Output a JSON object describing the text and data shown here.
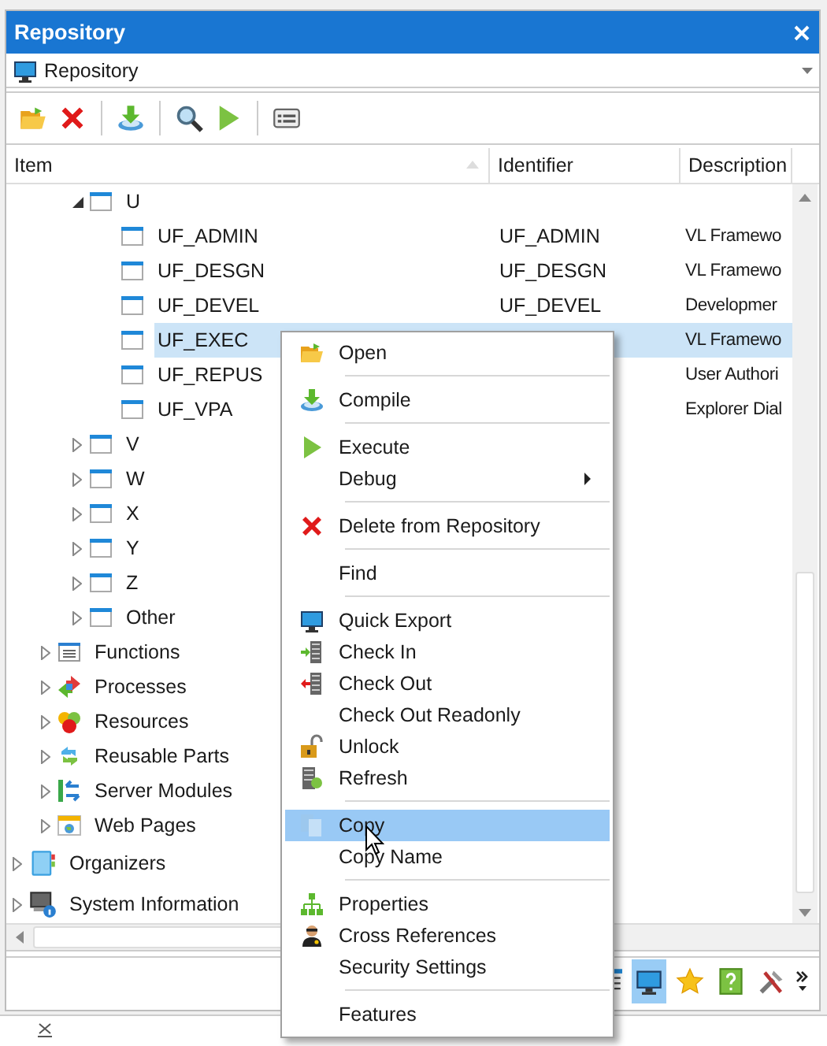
{
  "window": {
    "title": "Repository"
  },
  "selector": {
    "value": "Repository"
  },
  "table": {
    "columns": [
      "Item",
      "Identifier",
      "Description"
    ]
  },
  "tree": {
    "items": [
      {
        "children": [
          {
            "children": [
              {
                "label": "U",
                "kind": "table",
                "expanded": true,
                "selected": false,
                "children": [
                  {
                    "label": "UF_ADMIN",
                    "kind": "table",
                    "identifier": "UF_ADMIN",
                    "description": "VL Framewo",
                    "selected": false
                  },
                  {
                    "label": "UF_DESGN",
                    "kind": "table",
                    "identifier": "UF_DESGN",
                    "description": "VL Framewo",
                    "selected": false
                  },
                  {
                    "label": "UF_DEVEL",
                    "kind": "table",
                    "identifier": "UF_DEVEL",
                    "description": "Developmer",
                    "selected": false
                  },
                  {
                    "label": "UF_EXEC",
                    "kind": "table",
                    "description": "VL Framewo",
                    "selected": true
                  },
                  {
                    "label": "UF_REPUS",
                    "kind": "table",
                    "description": "User Authori",
                    "selected": false
                  },
                  {
                    "label": "UF_VPA",
                    "kind": "table",
                    "description": "Explorer Dial",
                    "selected": false
                  }
                ]
              },
              {
                "label": "V",
                "kind": "table",
                "expanded": false,
                "selected": false
              },
              {
                "label": "W",
                "kind": "table",
                "expanded": false,
                "selected": false
              },
              {
                "label": "X",
                "kind": "table",
                "expanded": false,
                "selected": false
              },
              {
                "label": "Y",
                "kind": "table",
                "expanded": false,
                "selected": false
              },
              {
                "label": "Z",
                "kind": "table",
                "expanded": false,
                "selected": false
              },
              {
                "label": "Other",
                "kind": "table",
                "expanded": false,
                "selected": false
              }
            ]
          },
          {
            "label": "Functions",
            "kind": "functions",
            "expanded": false,
            "selected": false
          },
          {
            "label": "Processes",
            "kind": "processes",
            "expanded": false,
            "selected": false
          },
          {
            "label": "Resources",
            "kind": "resources",
            "expanded": false,
            "selected": false
          },
          {
            "label": "Reusable Parts",
            "kind": "reusable",
            "expanded": false,
            "selected": false
          },
          {
            "label": "Server Modules",
            "kind": "server",
            "expanded": false,
            "selected": false
          },
          {
            "label": "Web Pages",
            "kind": "web",
            "expanded": false,
            "selected": false
          }
        ]
      },
      {
        "label": "Organizers",
        "kind": "organizers",
        "expanded": false,
        "selected": false
      },
      {
        "label": "System Information",
        "kind": "system",
        "expanded": false,
        "selected": false
      }
    ]
  },
  "context_menu": {
    "items": [
      {
        "kind": "item",
        "label": "Open",
        "selected": false
      },
      {
        "kind": "separator"
      },
      {
        "kind": "item",
        "label": "Compile",
        "selected": false
      },
      {
        "kind": "separator"
      },
      {
        "kind": "item",
        "label": "Execute",
        "selected": false
      },
      {
        "kind": "submenu",
        "label": "Debug",
        "selected": false
      },
      {
        "kind": "separator"
      },
      {
        "kind": "item",
        "label": "Delete from Repository",
        "selected": false
      },
      {
        "kind": "separator"
      },
      {
        "kind": "item",
        "label": "Find",
        "selected": false
      },
      {
        "kind": "separator"
      },
      {
        "kind": "item",
        "label": "Quick Export",
        "selected": false
      },
      {
        "kind": "item",
        "label": "Check In",
        "selected": false
      },
      {
        "kind": "item",
        "label": "Check Out",
        "selected": false
      },
      {
        "kind": "item",
        "label": "Check Out Readonly",
        "selected": false
      },
      {
        "kind": "item",
        "label": "Unlock",
        "selected": false
      },
      {
        "kind": "item",
        "label": "Refresh",
        "selected": false
      },
      {
        "kind": "separator"
      },
      {
        "kind": "item",
        "label": "Copy",
        "selected": true
      },
      {
        "kind": "item",
        "label": "Copy Name",
        "selected": false
      },
      {
        "kind": "separator"
      },
      {
        "kind": "item",
        "label": "Properties",
        "selected": false
      },
      {
        "kind": "item",
        "label": "Cross References",
        "selected": false
      },
      {
        "kind": "item",
        "label": "Security Settings",
        "selected": false
      },
      {
        "kind": "separator"
      },
      {
        "kind": "item",
        "label": "Features",
        "selected": false
      }
    ]
  },
  "bottom_toolbar": {
    "buttons": [
      {
        "selected": false
      },
      {
        "selected": true
      },
      {
        "selected": false
      },
      {
        "selected": false
      },
      {
        "selected": false
      }
    ]
  }
}
